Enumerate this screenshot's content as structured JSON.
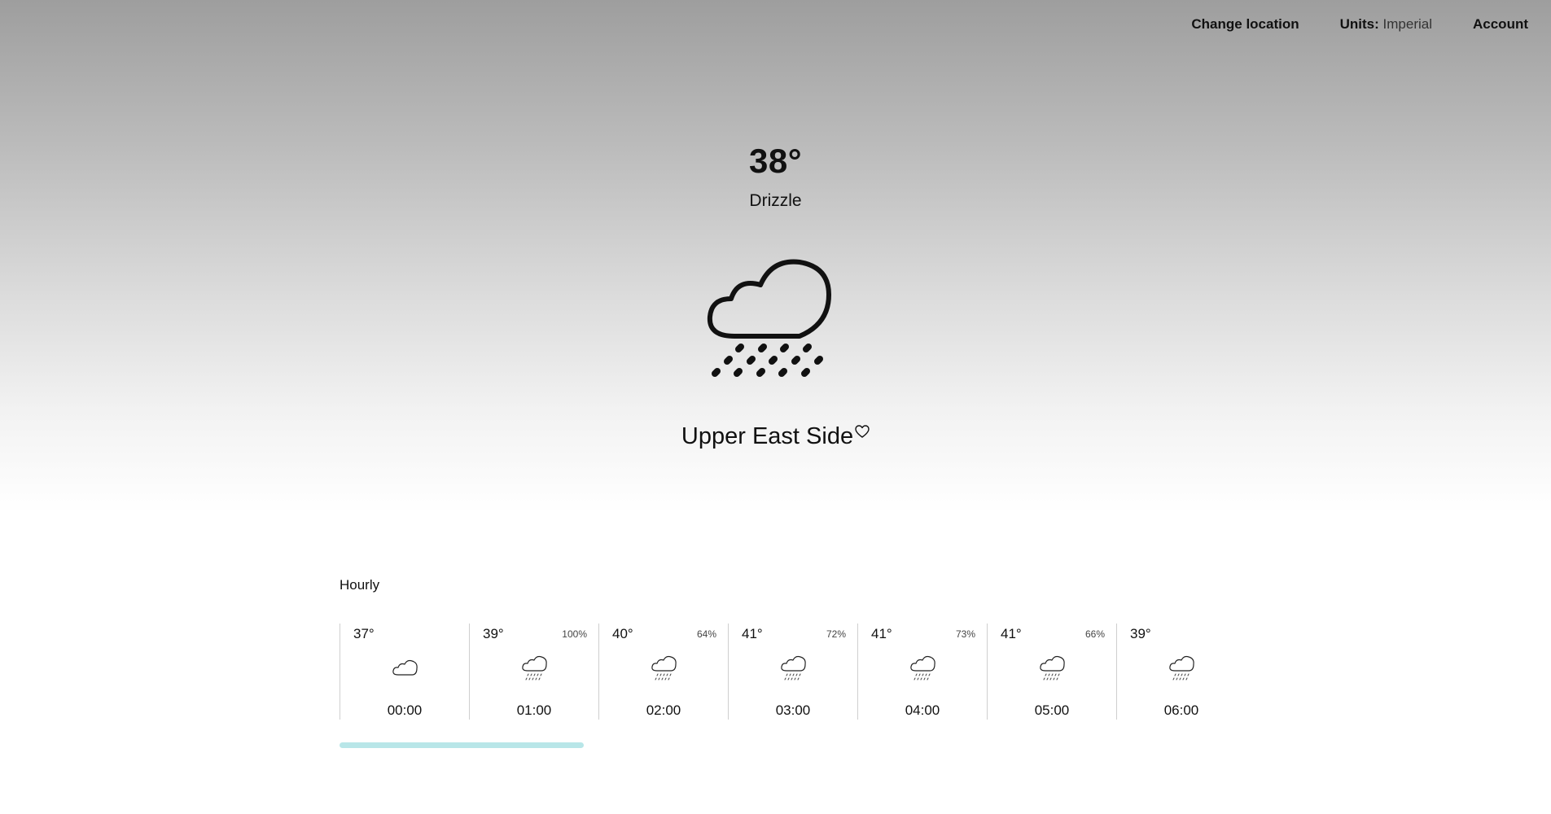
{
  "nav": {
    "change_location": "Change location",
    "units_label": "Units:",
    "units_value": "Imperial",
    "account": "Account"
  },
  "current": {
    "temperature": "38°",
    "condition": "Drizzle",
    "icon": "drizzle-icon",
    "location": "Upper East Side",
    "favorite_icon": "heart-outline-icon"
  },
  "hourly": {
    "title": "Hourly",
    "items": [
      {
        "temp": "37°",
        "precip": "",
        "time": "00:00",
        "icon": "cloud-icon"
      },
      {
        "temp": "39°",
        "precip": "100%",
        "time": "01:00",
        "icon": "drizzle-icon"
      },
      {
        "temp": "40°",
        "precip": "64%",
        "time": "02:00",
        "icon": "drizzle-icon"
      },
      {
        "temp": "41°",
        "precip": "72%",
        "time": "03:00",
        "icon": "drizzle-icon"
      },
      {
        "temp": "41°",
        "precip": "73%",
        "time": "04:00",
        "icon": "drizzle-icon"
      },
      {
        "temp": "41°",
        "precip": "66%",
        "time": "05:00",
        "icon": "drizzle-icon"
      },
      {
        "temp": "39°",
        "precip": "",
        "time": "06:00",
        "icon": "drizzle-icon"
      }
    ]
  },
  "colors": {
    "scroll_thumb": "#b8e6e8",
    "hero_top": "#9e9e9e",
    "hero_bottom": "#ffffff"
  }
}
